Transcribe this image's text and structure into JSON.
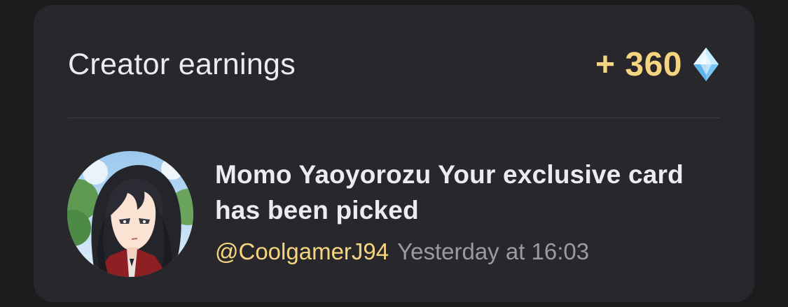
{
  "card": {
    "title": "Creator earnings",
    "earnings": {
      "amount": "+ 360",
      "icon": "diamond-gem-icon"
    }
  },
  "notification": {
    "avatar": "character-avatar",
    "message": "Momo Yaoyorozu Your exclusive card has been picked",
    "handle": "@CoolgamerJ94",
    "timestamp": "Yesterday at 16:03"
  },
  "colors": {
    "background": "#1c1c1f",
    "card": "#28282c",
    "accent": "#f6d580",
    "text": "#ececf0",
    "muted": "#9a9aa0",
    "gem": "#8fd3ff"
  }
}
